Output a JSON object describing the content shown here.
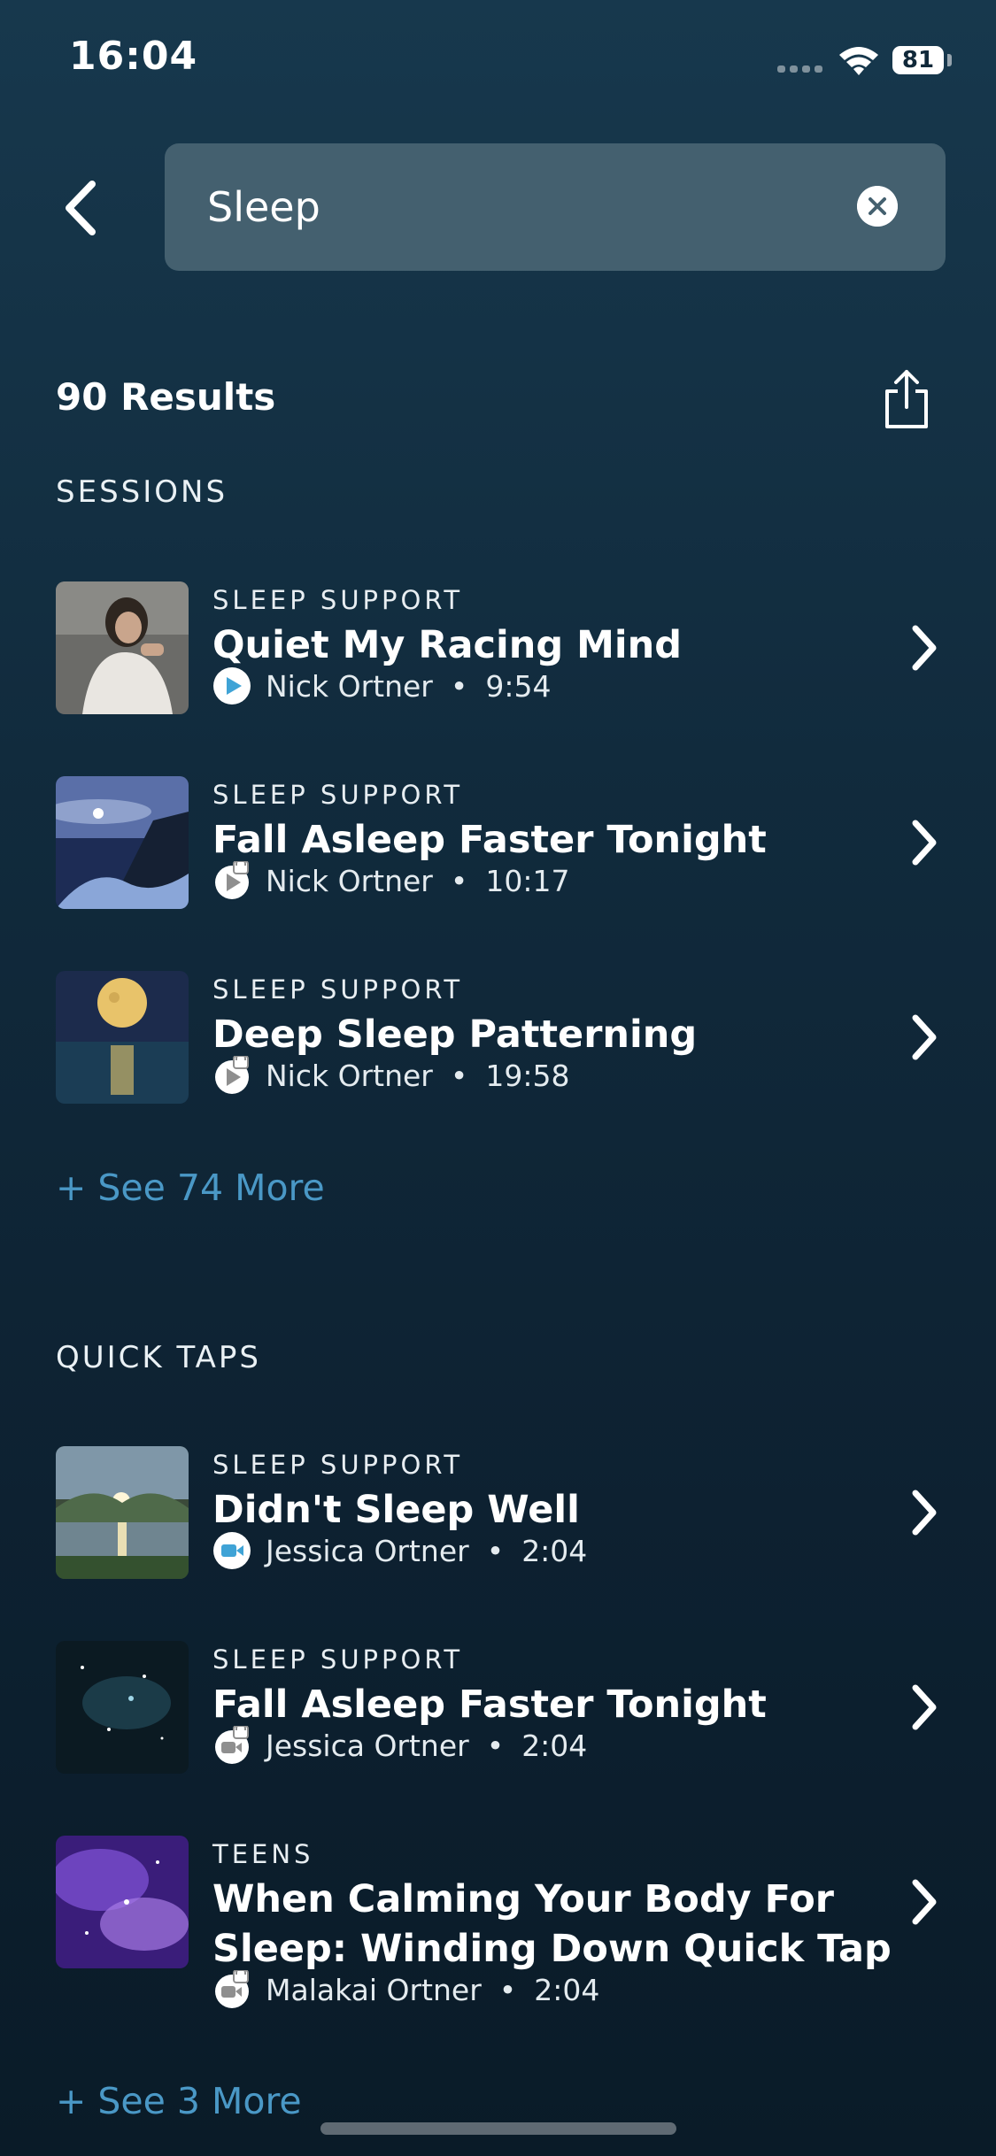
{
  "status_bar": {
    "time": "16:04",
    "battery": "81"
  },
  "search": {
    "query": "Sleep"
  },
  "results_count": "90 Results",
  "sessions": {
    "heading": "SESSIONS",
    "items": [
      {
        "category": "SLEEP SUPPORT",
        "title": "Quiet My Racing Mind",
        "author": "Nick Ortner",
        "duration": "9:54"
      },
      {
        "category": "SLEEP SUPPORT",
        "title": "Fall Asleep Faster Tonight",
        "author": "Nick Ortner",
        "duration": "10:17"
      },
      {
        "category": "SLEEP SUPPORT",
        "title": "Deep Sleep Patterning",
        "author": "Nick Ortner",
        "duration": "19:58"
      }
    ],
    "see_more": "+ See 74 More"
  },
  "quick_taps": {
    "heading": "QUICK TAPS",
    "items": [
      {
        "category": "SLEEP SUPPORT",
        "title": "Didn't Sleep Well",
        "author": "Jessica Ortner",
        "duration": "2:04"
      },
      {
        "category": "SLEEP SUPPORT",
        "title": "Fall Asleep Faster Tonight",
        "author": "Jessica Ortner",
        "duration": "2:04"
      },
      {
        "category": "TEENS",
        "title_line1": "When Calming Your Body For",
        "title_line2": "Sleep: Winding Down Quick Tap",
        "author": "Malakai Ortner",
        "duration": "2:04"
      }
    ],
    "see_more": "+ See 3 More"
  },
  "colors": {
    "accent": "#4a98c6",
    "search_bg": "#44606f",
    "background_top": "#17384d",
    "background_bottom": "#0a1b28"
  }
}
